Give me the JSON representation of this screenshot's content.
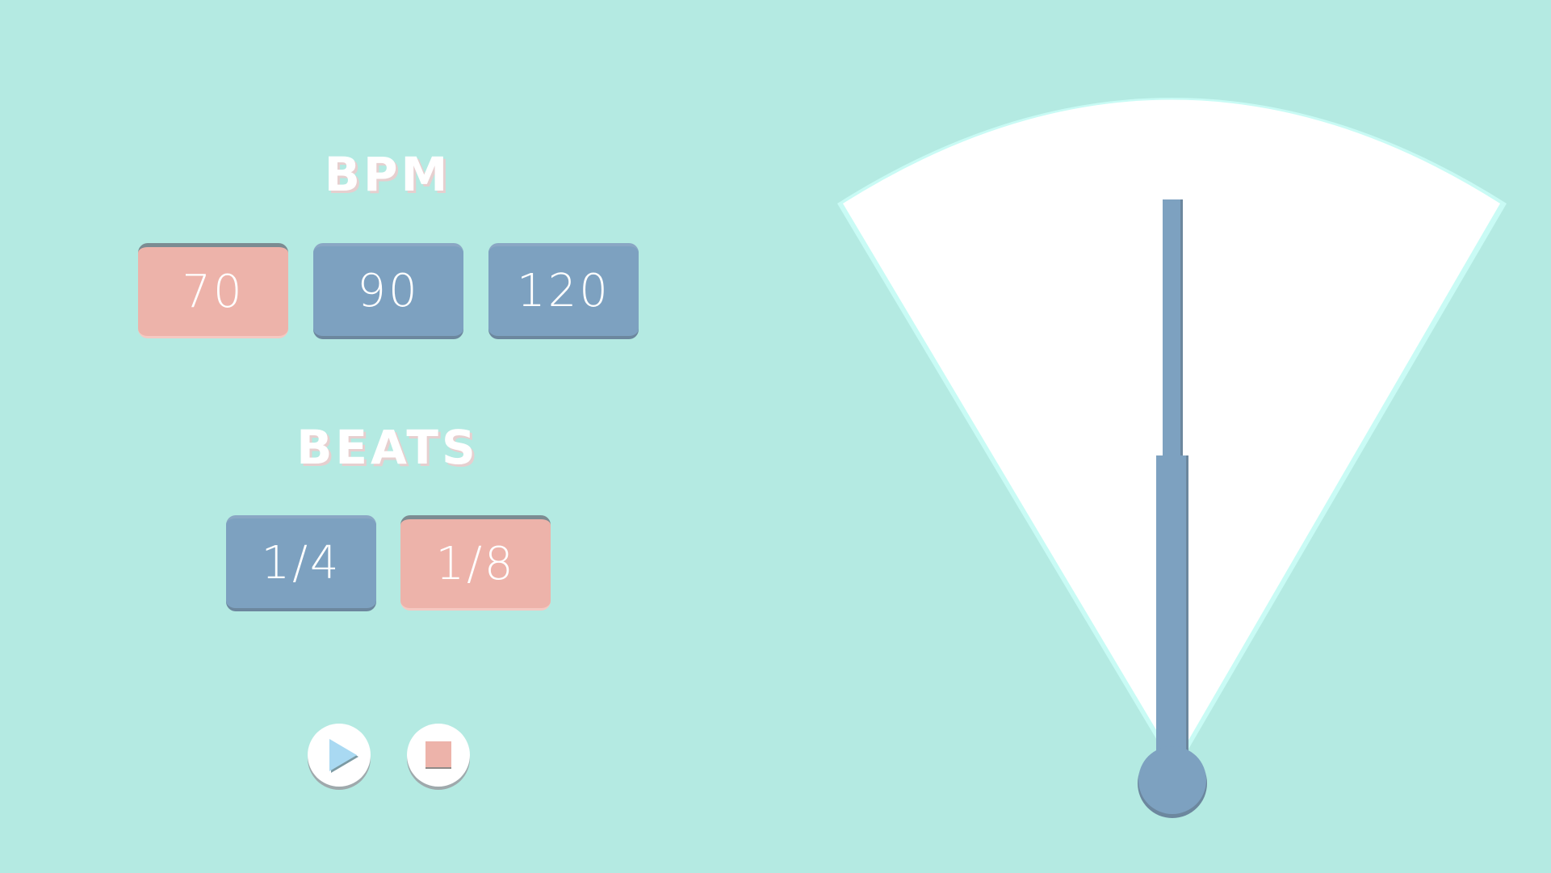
{
  "bpm": {
    "title": "BPM",
    "options": [
      {
        "label": "70",
        "selected": true
      },
      {
        "label": "90",
        "selected": false
      },
      {
        "label": "120",
        "selected": false
      }
    ]
  },
  "beats": {
    "title": "BEATS",
    "options": [
      {
        "label": "1/4",
        "selected": false
      },
      {
        "label": "1/8",
        "selected": true
      }
    ]
  },
  "controls": {
    "play_icon": "play-icon",
    "stop_icon": "stop-icon"
  },
  "colors": {
    "background": "#b4eae2",
    "button_inactive": "#7da1c0",
    "button_active": "#edb3aa",
    "pendulum": "#7da1c0",
    "dial": "#ffffff",
    "dial_edge": "#c9fbf5"
  }
}
